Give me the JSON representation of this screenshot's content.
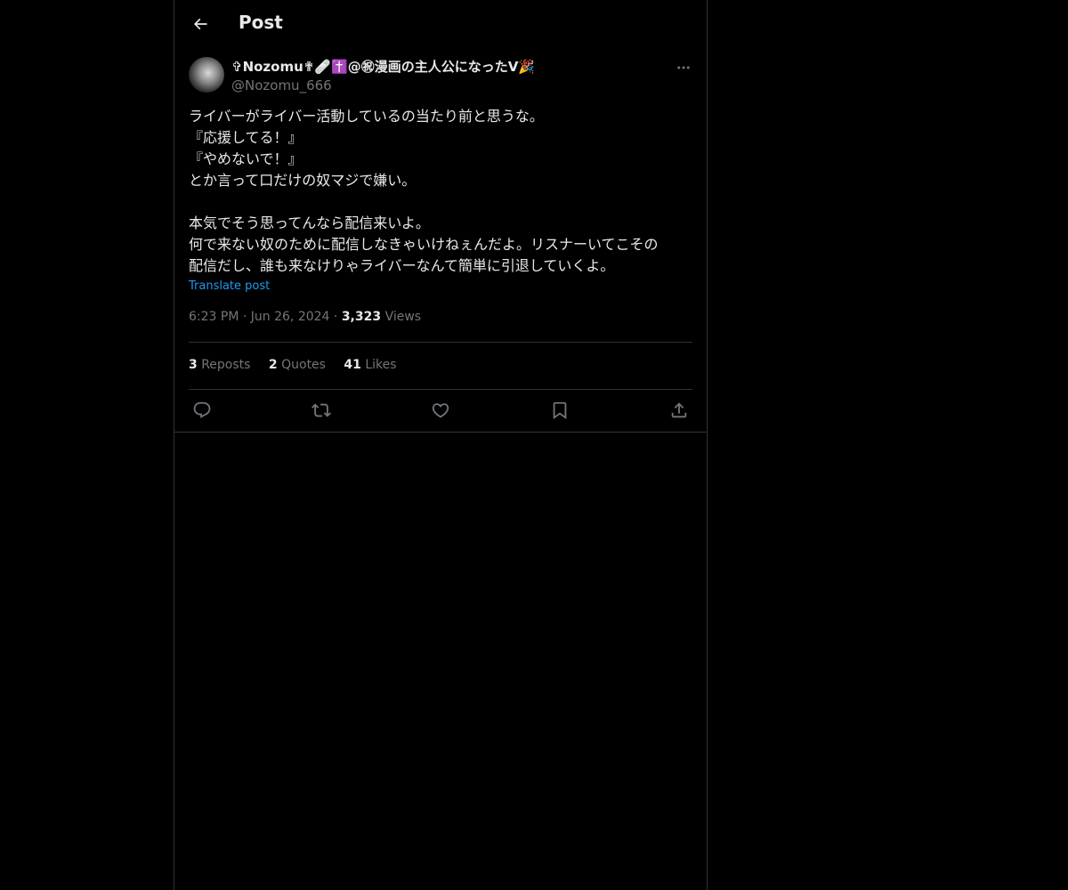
{
  "header": {
    "title": "Post"
  },
  "post": {
    "display_name": "✞Nozomu✟🩹✝️@㊗漫画の主人公になったV🎉",
    "handle": "@Nozomu_666",
    "lines": [
      "ライバーがライバー活動しているの当たり前と思うな。",
      "『応援してる！』",
      "『やめないで！』",
      "とか言って口だけの奴マジで嫌い。",
      "",
      "本気でそう思ってんなら配信来いよ。",
      "何で来ない奴のために配信しなきゃいけねぇんだよ。リスナーいてこその",
      "配信だし、誰も来なけりゃライバーなんて簡単に引退していくよ。"
    ],
    "translate_label": "Translate post",
    "time": "6:23 PM",
    "date": "Jun 26, 2024",
    "separator": "·",
    "views_count": "3,323",
    "views_label": "Views"
  },
  "stats": {
    "reposts_count": "3",
    "reposts_label": "Reposts",
    "quotes_count": "2",
    "quotes_label": "Quotes",
    "likes_count": "41",
    "likes_label": "Likes"
  },
  "icons": {
    "back": "back-arrow-icon",
    "more": "more-horizontal-icon",
    "reply": "reply-icon",
    "repost": "repost-icon",
    "like": "heart-icon",
    "bookmark": "bookmark-icon",
    "share": "share-icon"
  },
  "colors": {
    "background": "#000000",
    "text": "#e7e9ea",
    "secondary": "#71767b",
    "link": "#1d9bf0",
    "border": "#2f3336"
  }
}
